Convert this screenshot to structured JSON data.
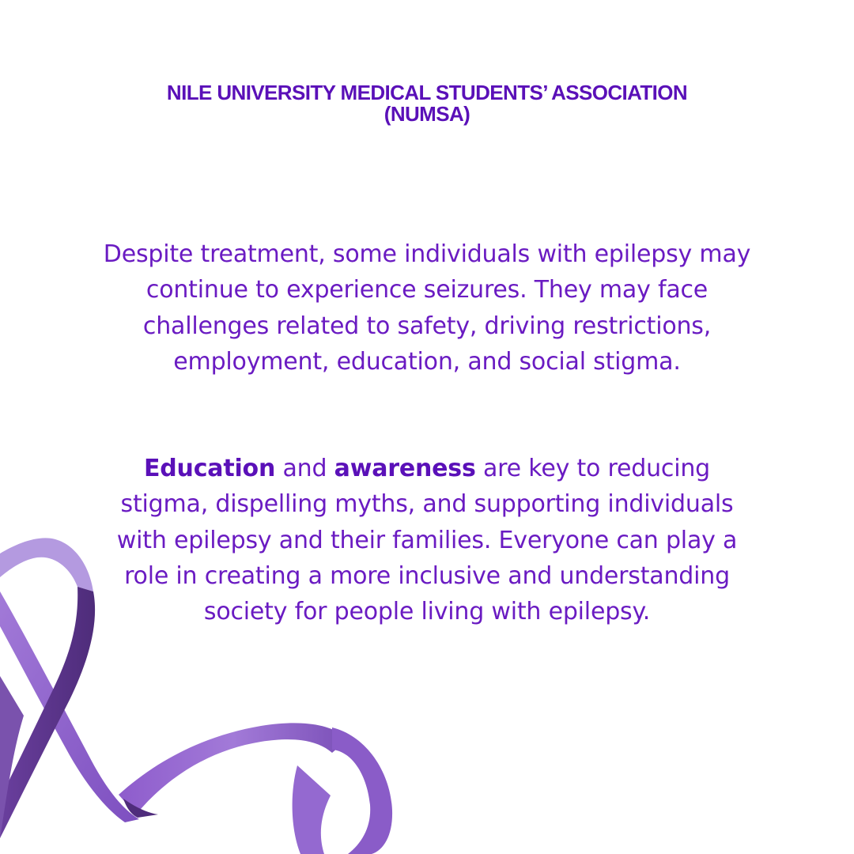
{
  "header": {
    "line1": "NILE UNIVERSITY MEDICAL STUDENTS’ ASSOCIATION",
    "line2": "(NUMSA)"
  },
  "paragraph1": "Despite treatment, some individuals with epilepsy may continue to experience seizures. They may face challenges related to safety, driving restrictions, employment, education, and social stigma.",
  "paragraph2": {
    "bold1": "Education",
    "text1": " and ",
    "bold2": "awareness",
    "text2": " are key to reducing stigma, dispelling myths, and supporting individuals with epilepsy and their families. Everyone can play a role in creating a more inclusive and understanding society for people living with epilepsy."
  },
  "decoration": {
    "icon": "purple-awareness-ribbon-icon",
    "colors": {
      "text": "#6a1bc2",
      "heading": "#5a10b8",
      "ribbon_light": "#9c6fd6",
      "ribbon_mid": "#8b5cc9",
      "ribbon_dark": "#5e3a8c"
    }
  }
}
